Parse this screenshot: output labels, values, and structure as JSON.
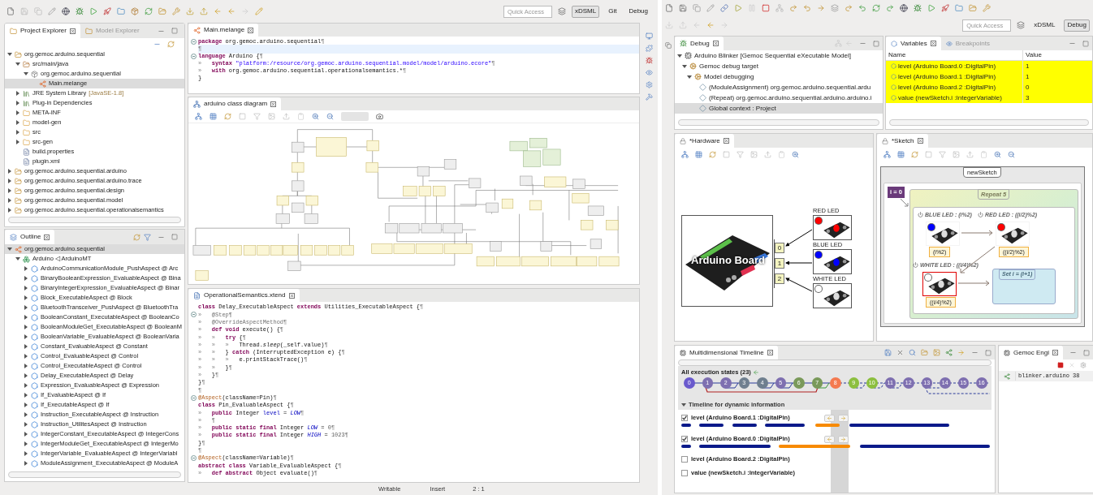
{
  "left_window": {
    "toolbar": {
      "quick_access": {
        "placeholder": "Quick Access"
      },
      "perspectives": [
        {
          "label": "xDSML",
          "selected": true
        },
        {
          "label": "Git",
          "selected": false
        },
        {
          "label": "Debug",
          "selected": false
        }
      ]
    },
    "project_explorer": {
      "tabs": [
        {
          "label": "Project Explorer",
          "selected": true
        },
        {
          "label": "Model Explorer",
          "selected": false
        }
      ],
      "tree": [
        {
          "label": "org.gemoc.arduino.sequential",
          "kind": "project",
          "expanded": true,
          "selected": false,
          "children": [
            {
              "label": "src/main/java",
              "kind": "source_folder",
              "expanded": true,
              "selected": false,
              "children": [
                {
                  "label": "org.gemoc.arduino.sequential",
                  "kind": "package",
                  "expanded": true,
                  "selected": false,
                  "children": [
                    {
                      "label": "Main.melange",
                      "kind": "melange",
                      "selected": true
                    }
                  ]
                }
              ]
            },
            {
              "label": "JRE System Library",
              "decoration": "[JavaSE-1.8]",
              "kind": "library",
              "expanded": false,
              "selected": false
            },
            {
              "label": "Plug-in Dependencies",
              "kind": "library",
              "expanded": false,
              "selected": false
            },
            {
              "label": "META-INF",
              "kind": "folder",
              "expanded": false,
              "selected": false
            },
            {
              "label": "model-gen",
              "kind": "folder",
              "expanded": false,
              "selected": false
            },
            {
              "label": "src",
              "kind": "folder",
              "expanded": false,
              "selected": false
            },
            {
              "label": "src-gen",
              "kind": "folder",
              "expanded": false,
              "selected": false
            },
            {
              "label": "build.properties",
              "kind": "file",
              "selected": false
            },
            {
              "label": "plugin.xml",
              "kind": "file",
              "selected": false
            }
          ]
        },
        {
          "label": "org.gemoc.arduino.sequential.arduino",
          "kind": "project",
          "expanded": false,
          "selected": false
        },
        {
          "label": "org.gemoc.arduino.sequential.arduino.trace",
          "kind": "project",
          "expanded": false,
          "selected": false
        },
        {
          "label": "org.gemoc.arduino.sequential.design",
          "kind": "project",
          "expanded": false,
          "selected": false
        },
        {
          "label": "org.gemoc.arduino.sequential.model",
          "kind": "project",
          "expanded": false,
          "selected": false
        },
        {
          "label": "org.gemoc.arduino.sequential.operationalsemantics",
          "kind": "project",
          "expanded": false,
          "selected": false
        }
      ]
    },
    "outline": {
      "title": "Outline",
      "tree": [
        {
          "label": "org.gemoc.arduino.sequential",
          "kind": "melange",
          "expanded": true,
          "selected": true,
          "children": [
            {
              "label": "Arduino ◁ ArduinoMT",
              "kind": "language",
              "expanded": true,
              "selected": false,
              "children": [
                {
                  "label": "ArduinoCommunicationModule_PushAspect @ Arc",
                  "kind": "aspect",
                  "expanded": false,
                  "selected": false
                },
                {
                  "label": "BinaryBooleanExpression_EvaluableAspect @ Bina",
                  "kind": "aspect",
                  "expanded": false,
                  "selected": false
                },
                {
                  "label": "BinaryIntegerExpression_EvaluableAspect @ Binar",
                  "kind": "aspect",
                  "expanded": false,
                  "selected": false
                },
                {
                  "label": "Block_ExecutableAspect @ Block",
                  "kind": "aspect",
                  "expanded": false,
                  "selected": false
                },
                {
                  "label": "BluetoothTransceiver_PushAspect @ BluetoothTra",
                  "kind": "aspect",
                  "expanded": false,
                  "selected": false
                },
                {
                  "label": "BooleanConstant_ExecutableAspect @ BooleanCo",
                  "kind": "aspect",
                  "expanded": false,
                  "selected": false
                },
                {
                  "label": "BooleanModuleGet_ExecutableAspect @ BooleanM",
                  "kind": "aspect",
                  "expanded": false,
                  "selected": false
                },
                {
                  "label": "BooleanVariable_EvaluableAspect @ BooleanVaria",
                  "kind": "aspect",
                  "expanded": false,
                  "selected": false
                },
                {
                  "label": "Constant_EvaluableAspect @ Constant",
                  "kind": "aspect",
                  "expanded": false,
                  "selected": false
                },
                {
                  "label": "Control_EvaluableAspect @ Control",
                  "kind": "aspect",
                  "expanded": false,
                  "selected": false
                },
                {
                  "label": "Control_ExecutableAspect @ Control",
                  "kind": "aspect",
                  "expanded": false,
                  "selected": false
                },
                {
                  "label": "Delay_ExecutableAspect @ Delay",
                  "kind": "aspect",
                  "expanded": false,
                  "selected": false
                },
                {
                  "label": "Expression_EvaluableAspect @ Expression",
                  "kind": "aspect",
                  "expanded": false,
                  "selected": false
                },
                {
                  "label": "If_EvaluableAspect @ If",
                  "kind": "aspect",
                  "expanded": false,
                  "selected": false
                },
                {
                  "label": "If_ExecutableAspect @ If",
                  "kind": "aspect",
                  "expanded": false,
                  "selected": false
                },
                {
                  "label": "Instruction_ExecutableAspect @ Instruction",
                  "kind": "aspect",
                  "expanded": false,
                  "selected": false
                },
                {
                  "label": "Instruction_UtilitesAspect @ Instruction",
                  "kind": "aspect",
                  "expanded": false,
                  "selected": false
                },
                {
                  "label": "IntegerConstant_ExecutableAspect @ IntegerCons",
                  "kind": "aspect",
                  "expanded": false,
                  "selected": false
                },
                {
                  "label": "IntegerModuleGet_ExecutableAspect @ IntegerMo",
                  "kind": "aspect",
                  "expanded": false,
                  "selected": false
                },
                {
                  "label": "IntegerVariable_EvaluableAspect @ IntegerVariabl",
                  "kind": "aspect",
                  "expanded": false,
                  "selected": false
                },
                {
                  "label": "ModuleAssignment_ExecutableAspect @ ModuleA",
                  "kind": "aspect",
                  "expanded": false,
                  "selected": false
                }
              ]
            }
          ]
        }
      ]
    },
    "melange_editor": {
      "tab": "Main.melange",
      "lines": [
        {
          "fold": true,
          "current": false,
          "tokens": [
            {
              "kind": "keyword",
              "text": "package"
            },
            {
              "kind": "plain",
              "text": " org.gemoc.arduino.sequential"
            },
            {
              "kind": "whitespace",
              "text": "¶"
            }
          ]
        },
        {
          "current": true,
          "tokens": [
            {
              "kind": "whitespace",
              "text": "¶"
            }
          ]
        },
        {
          "fold": true,
          "current": false,
          "tokens": [
            {
              "kind": "keyword",
              "text": "language"
            },
            {
              "kind": "plain",
              "text": " Arduino {"
            },
            {
              "kind": "whitespace",
              "text": "¶"
            }
          ]
        },
        {
          "current": false,
          "tokens": [
            {
              "kind": "whitespace",
              "text": "»   "
            },
            {
              "kind": "keyword",
              "text": "syntax"
            },
            {
              "kind": "string",
              "text": " \"platform:/resource/org.gemoc.arduino.sequential.model/model/arduino.ecore\""
            },
            {
              "kind": "whitespace",
              "text": "¶"
            }
          ]
        },
        {
          "current": false,
          "tokens": [
            {
              "kind": "whitespace",
              "text": "»   "
            },
            {
              "kind": "keyword",
              "text": "with"
            },
            {
              "kind": "plain",
              "text": " org.gemoc.arduino.sequential.operationalsemantics.*"
            },
            {
              "kind": "whitespace",
              "text": "¶"
            }
          ]
        },
        {
          "current": false,
          "tokens": [
            {
              "kind": "plain",
              "text": "}"
            }
          ]
        }
      ]
    },
    "class_diagram": {
      "tab": "arduino class diagram"
    },
    "xtend_editor": {
      "tab": "OperationalSemantics.xtend",
      "lines": [
        {
          "tokens": [
            {
              "kind": "keyword",
              "text": "class"
            },
            {
              "kind": "plain",
              "text": " Delay_ExecutableAspect "
            },
            {
              "kind": "keyword",
              "text": "extends"
            },
            {
              "kind": "plain",
              "text": " Utilities_ExecutableAspect {"
            },
            {
              "kind": "whitespace",
              "text": "¶"
            }
          ]
        },
        {
          "fold": true,
          "tokens": [
            {
              "kind": "whitespace",
              "text": "»   "
            },
            {
              "kind": "meta",
              "text": "@Step"
            },
            {
              "kind": "whitespace",
              "text": "¶"
            }
          ]
        },
        {
          "tokens": [
            {
              "kind": "whitespace",
              "text": "»   "
            },
            {
              "kind": "meta",
              "text": "@OverrideAspectMethod"
            },
            {
              "kind": "whitespace",
              "text": "¶"
            }
          ]
        },
        {
          "tokens": [
            {
              "kind": "whitespace",
              "text": "»   "
            },
            {
              "kind": "keyword",
              "text": "def void"
            },
            {
              "kind": "plain",
              "text": " execute() {"
            },
            {
              "kind": "whitespace",
              "text": "¶"
            }
          ]
        },
        {
          "tokens": [
            {
              "kind": "whitespace",
              "text": "»   »   "
            },
            {
              "kind": "keyword",
              "text": "try"
            },
            {
              "kind": "plain",
              "text": " {"
            },
            {
              "kind": "whitespace",
              "text": "¶"
            }
          ]
        },
        {
          "tokens": [
            {
              "kind": "whitespace",
              "text": "»   »   »   "
            },
            {
              "kind": "plain",
              "text": "Thread."
            },
            {
              "kind": "italic",
              "text": "sleep"
            },
            {
              "kind": "plain",
              "text": "(_self.value)"
            },
            {
              "kind": "whitespace",
              "text": "¶"
            }
          ]
        },
        {
          "tokens": [
            {
              "kind": "whitespace",
              "text": "»   »   "
            },
            {
              "kind": "plain",
              "text": "} "
            },
            {
              "kind": "keyword",
              "text": "catch"
            },
            {
              "kind": "plain",
              "text": " (InterruptedException e) {"
            },
            {
              "kind": "whitespace",
              "text": "¶"
            }
          ]
        },
        {
          "tokens": [
            {
              "kind": "whitespace",
              "text": "»   »   »   "
            },
            {
              "kind": "plain",
              "text": "e.printStackTrace()"
            },
            {
              "kind": "whitespace",
              "text": "¶"
            }
          ]
        },
        {
          "tokens": [
            {
              "kind": "whitespace",
              "text": "»   »   "
            },
            {
              "kind": "plain",
              "text": "}"
            },
            {
              "kind": "whitespace",
              "text": "¶"
            }
          ]
        },
        {
          "tokens": [
            {
              "kind": "whitespace",
              "text": "»   "
            },
            {
              "kind": "plain",
              "text": "}"
            },
            {
              "kind": "whitespace",
              "text": "¶"
            }
          ]
        },
        {
          "tokens": [
            {
              "kind": "plain",
              "text": "}"
            },
            {
              "kind": "whitespace",
              "text": "¶"
            }
          ]
        },
        {
          "tokens": [
            {
              "kind": "whitespace",
              "text": "¶"
            }
          ]
        },
        {
          "fold": true,
          "tokens": [
            {
              "kind": "annotation",
              "text": "@Aspect"
            },
            {
              "kind": "plain",
              "text": "(className=Pin)"
            },
            {
              "kind": "whitespace",
              "text": "¶"
            }
          ]
        },
        {
          "tokens": [
            {
              "kind": "keyword",
              "text": "class"
            },
            {
              "kind": "plain",
              "text": " Pin_EvaluableAspect {"
            },
            {
              "kind": "whitespace",
              "text": "¶"
            }
          ]
        },
        {
          "tokens": [
            {
              "kind": "whitespace",
              "text": "»   "
            },
            {
              "kind": "keyword",
              "text": "public"
            },
            {
              "kind": "plain",
              "text": " Integer "
            },
            {
              "kind": "field",
              "text": "level"
            },
            {
              "kind": "plain",
              "text": " = "
            },
            {
              "kind": "constant",
              "text": "LOW"
            },
            {
              "kind": "whitespace",
              "text": "¶"
            }
          ]
        },
        {
          "tokens": [
            {
              "kind": "whitespace",
              "text": "»   ¶"
            }
          ]
        },
        {
          "tokens": [
            {
              "kind": "whitespace",
              "text": "»   "
            },
            {
              "kind": "keyword",
              "text": "public static final"
            },
            {
              "kind": "plain",
              "text": " Integer "
            },
            {
              "kind": "constant",
              "text": "LOW"
            },
            {
              "kind": "plain",
              "text": " = "
            },
            {
              "kind": "number",
              "text": "0"
            },
            {
              "kind": "whitespace",
              "text": "¶"
            }
          ]
        },
        {
          "tokens": [
            {
              "kind": "whitespace",
              "text": "»   "
            },
            {
              "kind": "keyword",
              "text": "public static final"
            },
            {
              "kind": "plain",
              "text": " Integer "
            },
            {
              "kind": "constant",
              "text": "HIGH"
            },
            {
              "kind": "plain",
              "text": " = "
            },
            {
              "kind": "number",
              "text": "1023"
            },
            {
              "kind": "whitespace",
              "text": "¶"
            }
          ]
        },
        {
          "tokens": [
            {
              "kind": "plain",
              "text": "}"
            },
            {
              "kind": "whitespace",
              "text": "¶"
            }
          ]
        },
        {
          "tokens": [
            {
              "kind": "whitespace",
              "text": "¶"
            }
          ]
        },
        {
          "fold": true,
          "tokens": [
            {
              "kind": "annotation",
              "text": "@Aspect"
            },
            {
              "kind": "plain",
              "text": "(className=Variable)"
            },
            {
              "kind": "whitespace",
              "text": "¶"
            }
          ]
        },
        {
          "tokens": [
            {
              "kind": "keyword",
              "text": "abstract class"
            },
            {
              "kind": "plain",
              "text": " Variable_EvaluableAspect {"
            },
            {
              "kind": "whitespace",
              "text": "¶"
            }
          ]
        },
        {
          "tokens": [
            {
              "kind": "whitespace",
              "text": "»   "
            },
            {
              "kind": "keyword",
              "text": "def abstract"
            },
            {
              "kind": "plain",
              "text": " Object evaluate()"
            },
            {
              "kind": "whitespace",
              "text": "¶"
            }
          ]
        }
      ]
    },
    "status_bar": [
      "Writable",
      "Insert",
      "2 : 1"
    ]
  },
  "right_window": {
    "toolbar": {
      "quick_access": {
        "placeholder": "Quick Access"
      },
      "perspectives": [
        {
          "label": "xDSML",
          "selected": false
        },
        {
          "label": "Debug",
          "selected": true
        }
      ]
    },
    "debug": {
      "tab": "Debug",
      "tree": [
        {
          "label": "Arduino Blinker [Gemoc Sequential eXecutable Model]",
          "kind": "launch",
          "expanded": true,
          "selected": false,
          "children": [
            {
              "label": "Gemoc debug target",
              "kind": "target",
              "expanded": true,
              "selected": false,
              "children": [
                {
                  "label": "Model debugging",
                  "kind": "target",
                  "expanded": true,
                  "selected": false,
                  "children": [
                    {
                      "label": "(ModuleAssignment) org.gemoc.arduino.sequential.ardu",
                      "kind": "frame",
                      "selected": false
                    },
                    {
                      "label": "(Repeat) org.gemoc.arduino.sequential.arduino.arduino.i",
                      "kind": "frame",
                      "selected": false
                    },
                    {
                      "label": "Global context : Project",
                      "kind": "frame",
                      "selected": true
                    }
                  ]
                }
              ]
            }
          ]
        }
      ]
    },
    "variables": {
      "tabs": [
        {
          "label": "Variables",
          "selected": true
        },
        {
          "label": "Breakpoints",
          "selected": false
        }
      ],
      "columns": [
        "Name",
        "Value"
      ],
      "rows": [
        {
          "name": "level (Arduino Board.0 :DigitalPin)",
          "value": "1",
          "changed": true
        },
        {
          "name": "level (Arduino Board.1 :DigitalPin)",
          "value": "1",
          "changed": true
        },
        {
          "name": "level (Arduino Board.2 :DigitalPin)",
          "value": "0",
          "changed": true
        },
        {
          "name": "value (newSketch.i :IntegerVariable)",
          "value": "3",
          "changed": true
        }
      ]
    },
    "hardware": {
      "tab": "*Hardware",
      "board": "Arduino Board",
      "pins": [
        "0",
        "1",
        "2"
      ],
      "leds": [
        {
          "label": "RED LED",
          "color": "#ff0000"
        },
        {
          "label": "BLUE LED",
          "color": "#0000ff"
        },
        {
          "label": "WHITE LED",
          "color": "#ffffff"
        }
      ]
    },
    "sketch": {
      "tab": "*Sketch",
      "title": "newSketch",
      "init": "i = 0",
      "loop": "Repeat 5",
      "leds": [
        {
          "label": "BLUE LED : (i%2)",
          "expression": "(i%2)",
          "color": "#0000ff",
          "active": false
        },
        {
          "label": "RED LED : ((i/2)%2)",
          "expression": "((i/2)%2)",
          "color": "#ff0000",
          "active": false
        },
        {
          "label": "WHITE LED : ((i/4)%2)",
          "expression": "((i/4)%2)",
          "color": "#ffffff",
          "active": true
        }
      ],
      "assignment": "Set i = (i+1)"
    },
    "timeline": {
      "tab": "Multidimensional Timeline",
      "states_title": "All execution states (23)",
      "states": [
        {
          "label": "0",
          "color": "#6a5acd"
        },
        {
          "label": "1",
          "color": "#7e6fb0"
        },
        {
          "label": "2",
          "color": "#7e6fb0"
        },
        {
          "label": "3",
          "color": "#6f7f8f"
        },
        {
          "label": "4",
          "color": "#6f7f8f"
        },
        {
          "label": "5",
          "color": "#7e6fb0"
        },
        {
          "label": "6",
          "color": "#7a9a5a"
        },
        {
          "label": "7",
          "color": "#7a9a5a"
        },
        {
          "label": "8",
          "color": "#f47a50"
        },
        {
          "label": "9",
          "color": "#8cbf3f"
        },
        {
          "label": "10",
          "color": "#8cbf3f"
        },
        {
          "label": "11",
          "color": "#7e6fb0"
        },
        {
          "label": "12",
          "color": "#7e6fb0"
        },
        {
          "label": "13",
          "color": "#7e6fb0"
        },
        {
          "label": "14",
          "color": "#7e6fb0"
        },
        {
          "label": "15",
          "color": "#7e6fb0"
        },
        {
          "label": "16",
          "color": "#7e6fb0"
        }
      ],
      "section": {
        "title": "Timeline for dynamic information",
        "expanded": true
      },
      "rows": [
        {
          "label": "level (Arduino Board.1 :DigitalPin)",
          "checked": true
        },
        {
          "label": "level (Arduino Board.0 :DigitalPin)",
          "checked": true
        },
        {
          "label": "level (Arduino Board.2 :DigitalPin)",
          "checked": false
        },
        {
          "label": "value (newSketch.i :IntegerVariable)",
          "checked": false
        }
      ]
    },
    "engine": {
      "tab": "Gemoc Engi",
      "rows": [
        {
          "name": "blinker.arduino",
          "value": "38"
        }
      ]
    }
  }
}
